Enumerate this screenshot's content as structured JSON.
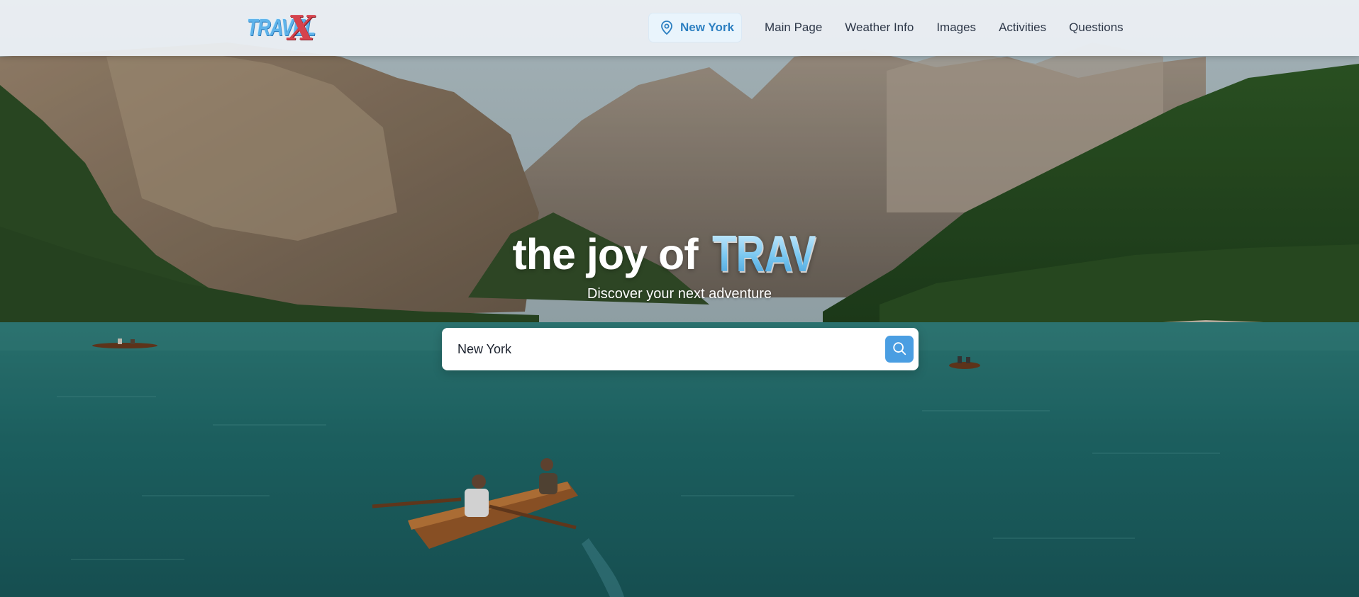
{
  "brand": {
    "logo_text": "TRAVEL",
    "logo_mark": "X",
    "logo_icon": "travelx-logo"
  },
  "header": {
    "location": {
      "label": "New York",
      "icon": "map-pin-icon"
    },
    "nav_items": [
      {
        "label": "Main Page"
      },
      {
        "label": "Weather Info"
      },
      {
        "label": "Images"
      },
      {
        "label": "Activities"
      },
      {
        "label": "Questions"
      }
    ]
  },
  "hero": {
    "title_lead": "the joy of",
    "title_accent": "TRAVEL",
    "subtitle": "Discover your next adventure",
    "background": "mountain-lake-rowboats-photo"
  },
  "search": {
    "value": "New York",
    "button_icon": "search-icon"
  },
  "colors": {
    "accent": "#4a9ee2",
    "location_text": "#2c7fc1",
    "nav_text": "#2d3748",
    "logo_x": "#d6434d"
  }
}
